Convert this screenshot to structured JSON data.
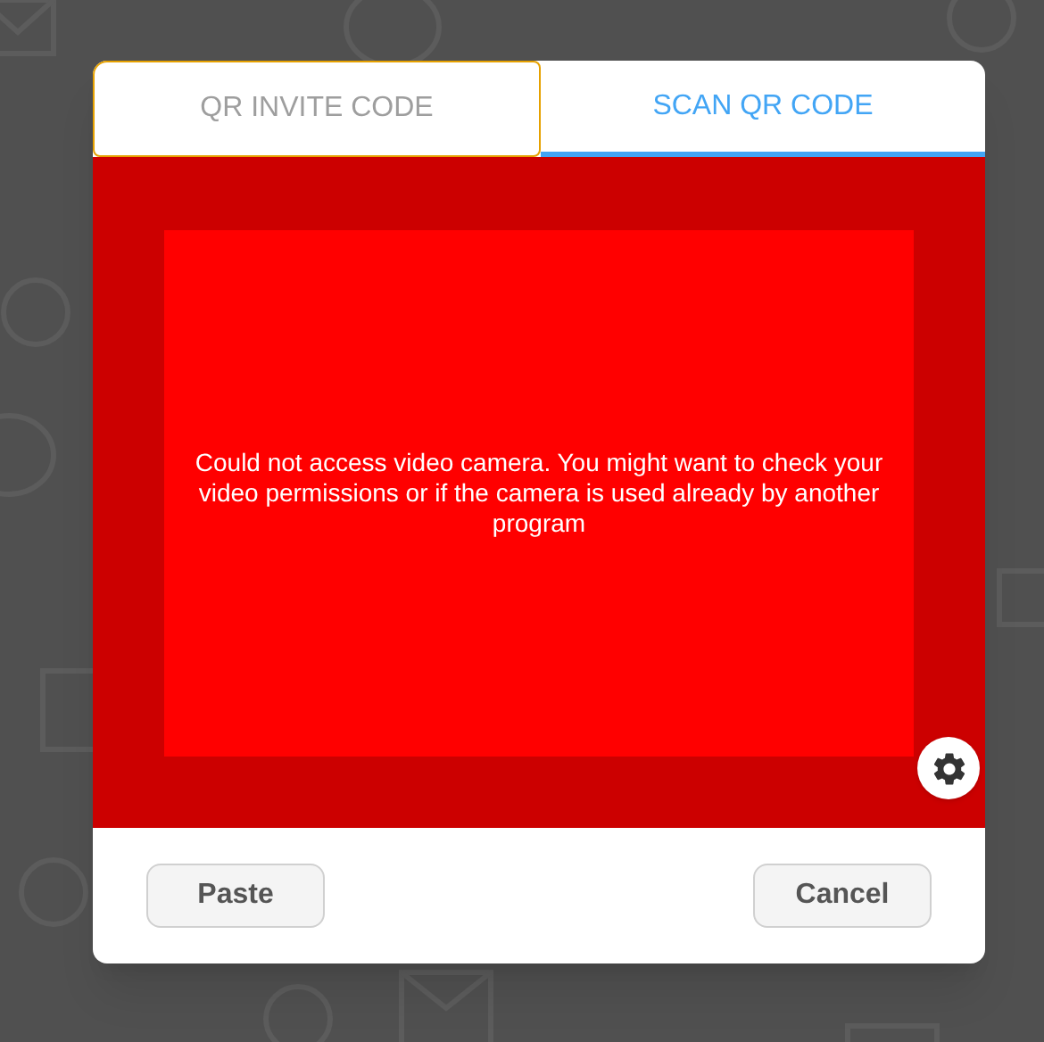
{
  "tabs": [
    {
      "label": "QR INVITE CODE",
      "selected": false,
      "focused": true
    },
    {
      "label": "SCAN QR CODE",
      "selected": true,
      "focused": false
    }
  ],
  "camera": {
    "error": "Could not access video camera. You might want to check your video permissions or if the camera is used already by another program"
  },
  "buttons": [
    "Paste",
    "Cancel"
  ]
}
